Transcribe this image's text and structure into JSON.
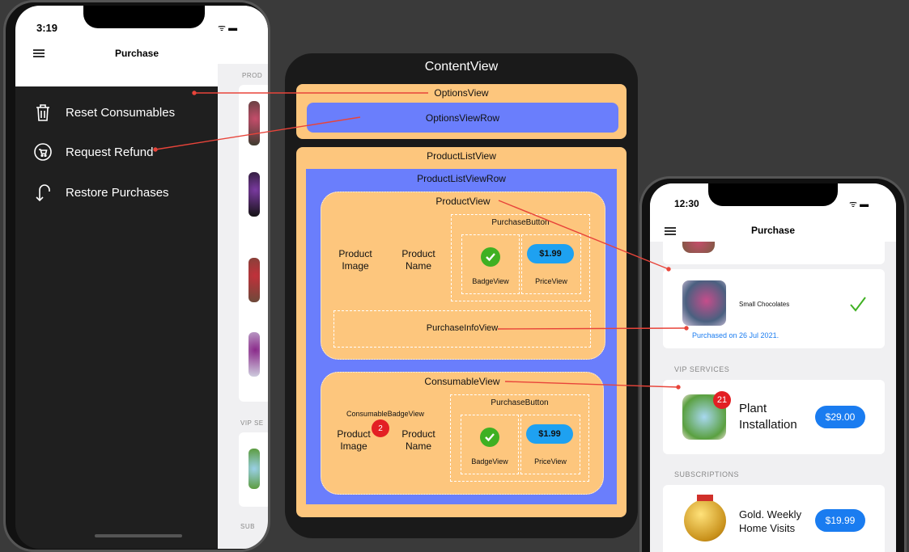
{
  "left_phone": {
    "time": "3:19",
    "title": "Purchase",
    "status_icons": "ᯤ ▬",
    "menu": [
      {
        "label": "Reset Consumables",
        "icon": "trash-icon"
      },
      {
        "label": "Request Refund",
        "icon": "cart-icon"
      },
      {
        "label": "Restore Purchases",
        "icon": "restore-arrow-icon"
      }
    ],
    "section_products": "PROD",
    "section_vip": "VIP SE",
    "section_subs": "SUB"
  },
  "diagram": {
    "content_view": "ContentView",
    "options_view": "OptionsView",
    "options_view_row": "OptionsViewRow",
    "product_list_view": "ProductListView",
    "product_list_view_row": "ProductListViewRow",
    "product_view": {
      "title": "ProductView",
      "product_image": "Product\nImage",
      "product_name": "Product\nName",
      "purchase_button": "PurchaseButton",
      "badge_view": "BadgeView",
      "price_view": "PriceView",
      "price": "$1.99",
      "purchase_info_view": "PurchaseInfoView"
    },
    "consumable_view": {
      "title": "ConsumableView",
      "consumable_badge_view": "ConsumableBadgeView",
      "badge_count": "2",
      "product_image": "Product\nImage",
      "product_name": "Product\nName",
      "purchase_button": "PurchaseButton",
      "badge_view": "BadgeView",
      "price_view": "PriceView",
      "price": "$1.99"
    }
  },
  "right_phone": {
    "time": "12:30",
    "title": "Purchase",
    "status_icons": "ᯤ ▬",
    "product": {
      "name": "Small Chocolates",
      "purchased_info": "Purchased on 26 Jul 2021."
    },
    "section_vip": "VIP SERVICES",
    "vip": {
      "name": "Plant\nInstallation",
      "badge": "21",
      "price": "$29.00"
    },
    "section_subs": "SUBSCRIPTIONS",
    "sub": {
      "name": "Gold. Weekly\nHome Visits",
      "price": "$19.99"
    }
  },
  "colors": {
    "orange": "#fdc67d",
    "blue": "#6a7efc",
    "arrow": "#e8443a",
    "price_blue": "#1ea1f1",
    "check_green": "#3fb022",
    "badge_red": "#e31f24"
  }
}
